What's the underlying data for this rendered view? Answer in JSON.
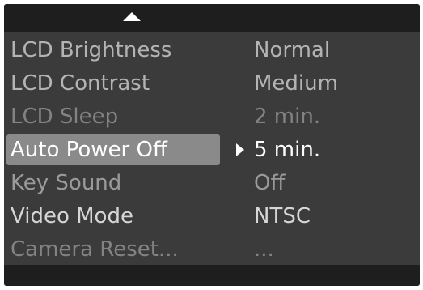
{
  "menu": {
    "items": [
      {
        "label": "LCD Brightness",
        "value": "Normal"
      },
      {
        "label": "LCD Contrast",
        "value": "Medium"
      },
      {
        "label": "LCD Sleep",
        "value": "2 min."
      },
      {
        "label": "Auto Power Off",
        "value": "5 min.",
        "selected": true
      },
      {
        "label": "Key Sound",
        "value": "Off"
      },
      {
        "label": "Video Mode",
        "value": "NTSC"
      },
      {
        "label": "Camera Reset...",
        "value": "..."
      }
    ]
  },
  "icons": {
    "scroll_up": "triangle-up-icon",
    "selection_pointer": "triangle-right-icon"
  },
  "colors": {
    "panel_background": "#3b3b3b",
    "bar_background": "#1e1e1e",
    "highlight": "#8a8a8a",
    "selected_text": "#ffffff"
  }
}
